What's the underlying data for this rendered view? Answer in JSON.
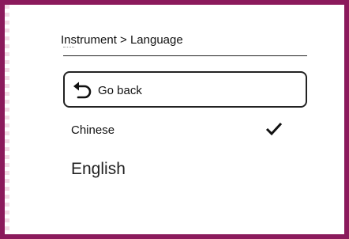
{
  "breadcrumb": "Instrument > Language",
  "back": {
    "label": "Go back",
    "icon": "undo-arrow-icon"
  },
  "languages": [
    {
      "label": "Chinese",
      "selected": true,
      "icon": "checkmark-icon"
    },
    {
      "label": "English",
      "selected": false
    }
  ],
  "colors": {
    "frame": "#8b1a5c",
    "text": "#111111"
  }
}
